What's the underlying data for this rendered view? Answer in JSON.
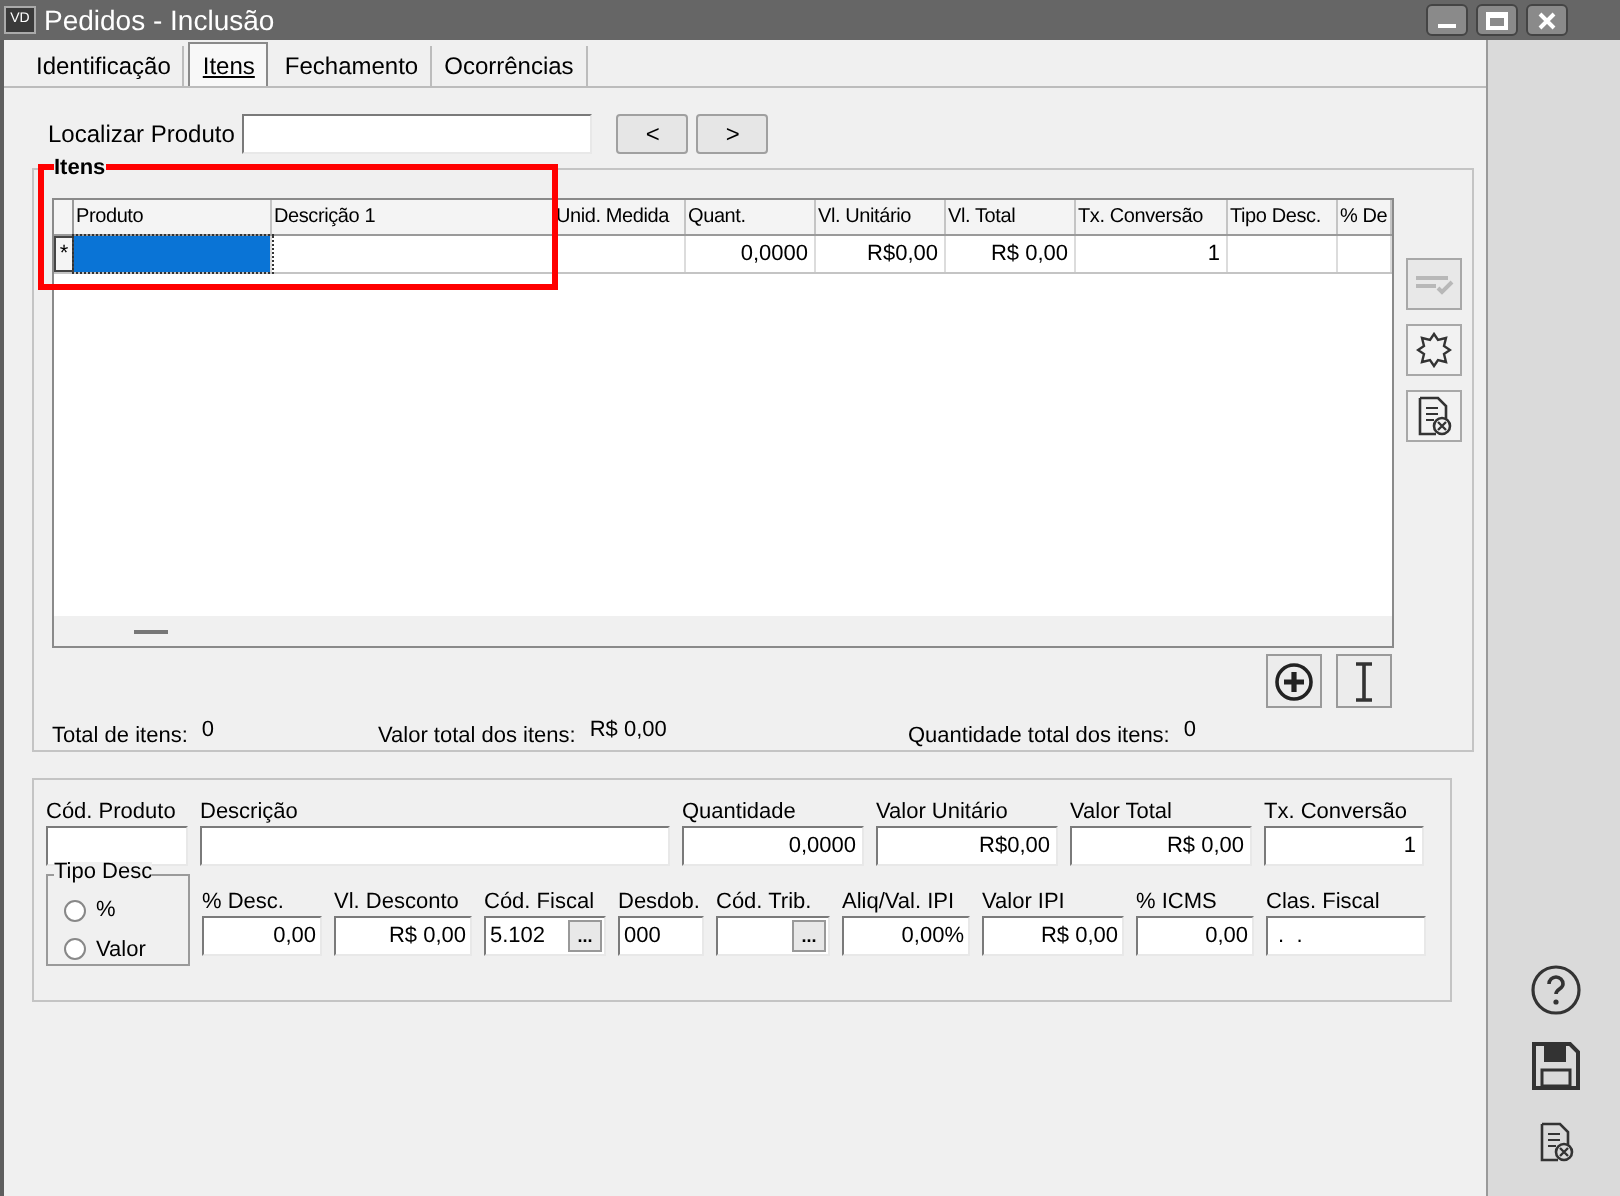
{
  "window": {
    "title": "Pedidos - Inclusão",
    "badge": "VD"
  },
  "tabs": [
    {
      "label": "Identificação",
      "selected": false
    },
    {
      "label": "Itens",
      "selected": true
    },
    {
      "label": "Fechamento",
      "selected": false
    },
    {
      "label": "Ocorrências",
      "selected": false
    }
  ],
  "search": {
    "label": "Localizar Produto",
    "prev": "<",
    "next": ">"
  },
  "items_group": {
    "title": "Itens",
    "table": {
      "columns": [
        {
          "label": "Produto"
        },
        {
          "label": "Descrição 1"
        },
        {
          "label": "Unid. Medida"
        },
        {
          "label": "Quant."
        },
        {
          "label": "Vl. Unitário"
        },
        {
          "label": "Vl. Total"
        },
        {
          "label": "Tx. Conversão"
        },
        {
          "label": "Tipo Desc."
        },
        {
          "label": "% De"
        }
      ],
      "rows": [
        {
          "marker": "*",
          "cells": [
            {
              "selected": true
            },
            {
              "selected": false
            },
            {
              "selected": false
            },
            {
              "text": "0,0000",
              "selected": false
            },
            {
              "text": "R$0,00",
              "selected": false
            },
            {
              "text": "R$ 0,00",
              "selected": false
            },
            {
              "text": "1",
              "selected": false
            },
            {
              "selected": false
            },
            {
              "selected": false
            }
          ]
        }
      ]
    },
    "side_buttons": [
      {
        "kind": "confirm",
        "disabled": true
      },
      {
        "kind": "star",
        "disabled": false
      },
      {
        "kind": "delete",
        "disabled": false
      }
    ],
    "bottom_buttons": [
      {
        "kind": "add"
      },
      {
        "kind": "insert"
      }
    ],
    "totals": [
      {
        "label": "Total de itens:",
        "value": "0"
      },
      {
        "label": "Valor total dos itens:",
        "value": "R$ 0,00"
      },
      {
        "label": "Quantidade total dos itens:",
        "value": "0"
      }
    ]
  },
  "detail": {
    "row1": [
      {
        "label": "Cód. Produto"
      },
      {
        "label": "Descrição"
      },
      {
        "label": "Quantidade",
        "value": "0,0000"
      },
      {
        "label": "Valor Unitário",
        "value": "R$0,00"
      },
      {
        "label": "Valor Total",
        "value": "R$ 0,00"
      },
      {
        "label": "Tx. Conversão",
        "value": "1"
      }
    ],
    "discount_type": {
      "title": "Tipo Desc",
      "options": [
        {
          "label": "%",
          "selected": false
        },
        {
          "label": "Valor",
          "selected": false
        }
      ]
    },
    "row2": [
      {
        "label": "% Desc.",
        "value": "0,00",
        "kind": "number"
      },
      {
        "label": "Vl. Desconto",
        "value": "R$ 0,00",
        "kind": "number"
      },
      {
        "label": "Cód. Fiscal",
        "value": "5.102",
        "kind": "code",
        "lookup": "..."
      },
      {
        "label": "Desdob.",
        "value": "000",
        "kind": "code"
      },
      {
        "label": "Cód. Trib.",
        "kind": "code",
        "lookup": "..."
      },
      {
        "label": "Aliq/Val. IPI",
        "value": "0,00%",
        "kind": "number"
      },
      {
        "label": "Valor IPI",
        "value": "R$ 0,00",
        "kind": "number"
      },
      {
        "label": "% ICMS",
        "value": "0,00",
        "kind": "number"
      },
      {
        "label": "Clas. Fiscal",
        "value": " .  .",
        "kind": "code"
      }
    ]
  },
  "sidebar": [
    {
      "kind": "help"
    },
    {
      "kind": "save"
    },
    {
      "kind": "cancel"
    }
  ]
}
